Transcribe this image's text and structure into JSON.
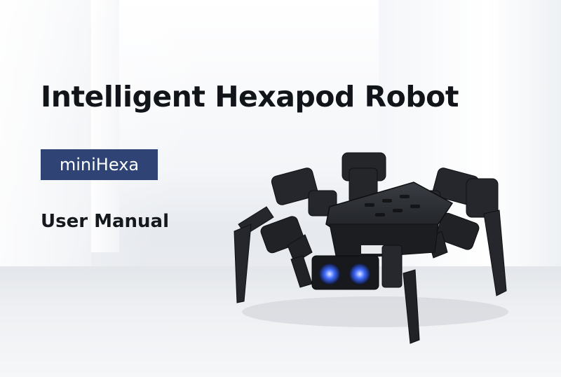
{
  "cover": {
    "title": "Intelligent Hexapod Robot",
    "model": "miniHexa",
    "subtitle": "User Manual"
  },
  "colors": {
    "badge_background": "#2f4474",
    "title_text": "#111418",
    "robot_body": "#202226",
    "sensor_glow": "#3f6bff"
  }
}
